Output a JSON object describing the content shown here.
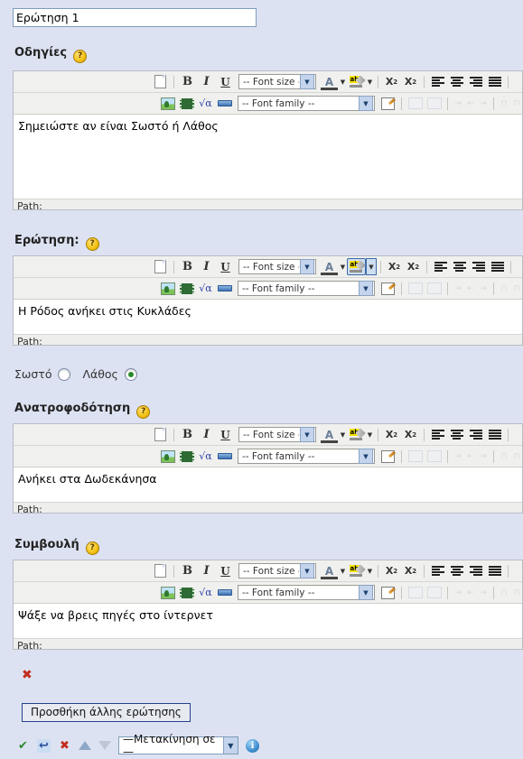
{
  "title_field": {
    "value": "Ερώτηση 1"
  },
  "sections": [
    {
      "label": "Οδηγίες",
      "help": "?",
      "content": "Σημειώστε αν είναι Σωστό ή Λάθος",
      "path_label": "Path:"
    },
    {
      "label": "Ερώτηση:",
      "help": "?",
      "content": "Η Ρόδος ανήκει στις Κυκλάδες",
      "path_label": "Path:"
    },
    {
      "label": "Ανατροφοδότηση",
      "help": "?",
      "content": "Ανήκει στα Δωδεκάνησα",
      "path_label": "Path:"
    },
    {
      "label": "Συμβουλή",
      "help": "?",
      "content": "Ψάξε να βρεις πηγές στο ίντερνετ",
      "path_label": "Path:"
    }
  ],
  "toolbar": {
    "font_size_label": "-- Font size --",
    "font_family_label": "-- Font family --",
    "bold": "B",
    "italic": "I",
    "underline": "U",
    "subscript": "X",
    "subscript_index": "2",
    "superscript": "X",
    "superscript_index": "2",
    "sqrt": "√α",
    "dropdown_caret": "▼",
    "icons": [
      "new-document-icon",
      "bold-icon",
      "italic-icon",
      "underline-icon",
      "font-size-select",
      "text-color-icon",
      "highlight-color-icon",
      "subscript-icon",
      "superscript-icon",
      "align-left-icon",
      "align-center-icon",
      "align-right-icon",
      "align-justify-icon",
      "insert-image-icon",
      "insert-media-icon",
      "insert-equation-icon",
      "horizontal-rule-icon",
      "font-family-select",
      "edit-html-icon",
      "insert-table-icon",
      "table-properties-icon",
      "outdent-icon",
      "indent-icon",
      "blockquote-icon",
      "cell-split-icon",
      "cell-merge-icon"
    ]
  },
  "answer_row": {
    "true_label": "Σωστό",
    "false_label": "Λάθος",
    "selected": "false"
  },
  "delete_icon": "✖",
  "add_question_button": {
    "label": "Προσθήκη άλλης ερώτησης"
  },
  "bottom_bar": {
    "confirm_icon": "✔",
    "undo_icon": "↩",
    "delete_icon": "✖",
    "move_up_icon": "▲",
    "move_down_icon": "▼",
    "move_select_label": "—Μετακίνηση σε—",
    "move_select_caret": "▼",
    "info_icon": "i"
  },
  "colors": {
    "page_background": "#dde2f2",
    "toolbar_background": "#f0f0ee",
    "input_border": "#7f9db9",
    "editor_border": "#b9bcc4",
    "radio_selected": "#2a8a2a",
    "delete_red": "#c22b1c",
    "button_border": "#22428c"
  }
}
